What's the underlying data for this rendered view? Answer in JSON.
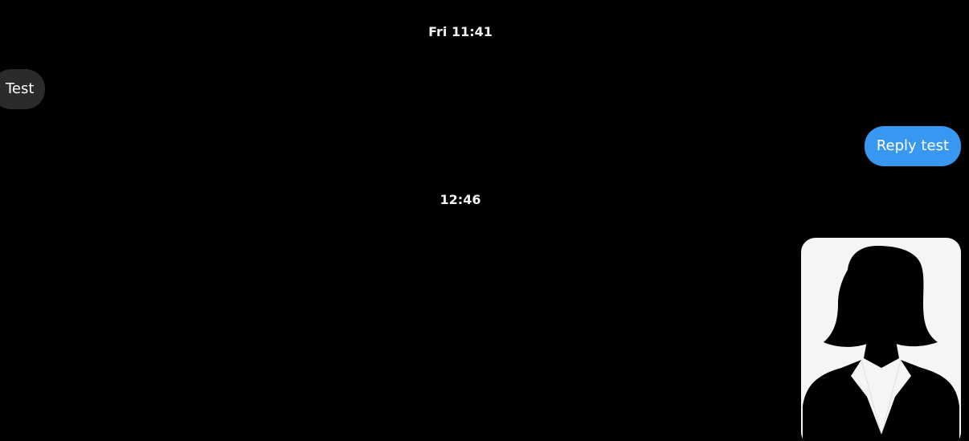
{
  "conversation": {
    "messages": [
      {
        "type": "timestamp",
        "text": "Fri 11:41"
      },
      {
        "type": "incoming",
        "text": "Test",
        "bubble_color": "#2b2b2b"
      },
      {
        "type": "outgoing",
        "text": "Reply test",
        "bubble_color": "#3897f0"
      },
      {
        "type": "timestamp",
        "text": "12:46"
      },
      {
        "type": "outgoing-image",
        "icon": "female-avatar-silhouette-icon",
        "background": "#f5f5f5"
      }
    ]
  },
  "theme": {
    "background": "#000000",
    "text": "#ffffff"
  }
}
